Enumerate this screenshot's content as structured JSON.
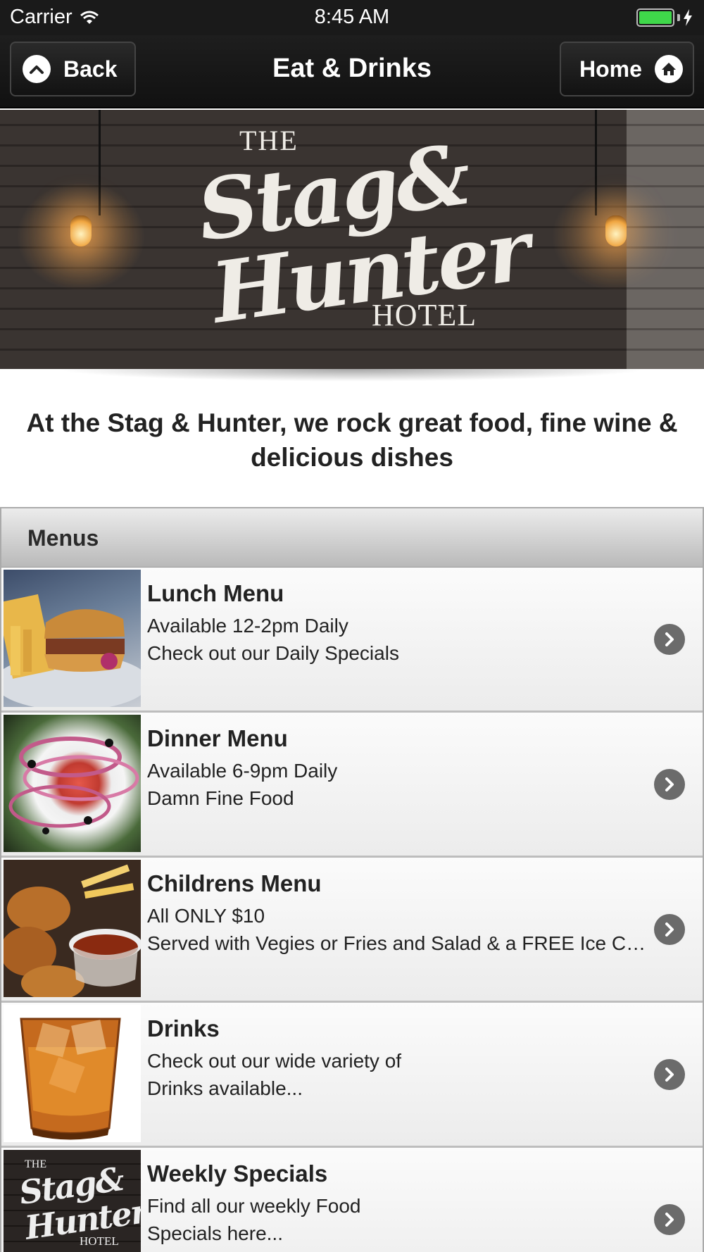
{
  "status_bar": {
    "carrier": "Carrier",
    "time": "8:45 AM"
  },
  "nav": {
    "back_label": "Back",
    "title": "Eat & Drinks",
    "home_label": "Home"
  },
  "banner": {
    "logo_the": "THE",
    "logo_stag": "Stag&",
    "logo_hunter": "Hunter",
    "logo_hotel": "HOTEL"
  },
  "intro_text": "At the Stag & Hunter, we rock great food, fine wine & delicious dishes",
  "menus": {
    "header": "Menus",
    "items": [
      {
        "title": "Lunch Menu",
        "line1": "Available 12-2pm Daily",
        "line2": "Check out our Daily Specials",
        "thumb_icon": "burger-photo"
      },
      {
        "title": "Dinner Menu",
        "line1": "Available 6-9pm Daily",
        "line2": "Damn Fine Food",
        "thumb_icon": "salad-photo"
      },
      {
        "title": "Childrens Menu",
        "line1": "All ONLY $10",
        "line2": "Served with Vegies or Fries and Salad & a FREE Ice Cream",
        "thumb_icon": "nuggets-photo"
      },
      {
        "title": "Drinks",
        "line1": "Check out our wide variety of",
        "line2": "Drinks available...",
        "thumb_icon": "whiskey-glass-photo"
      },
      {
        "title": "Weekly Specials",
        "line1": "Find all our weekly Food",
        "line2": "Specials here...",
        "thumb_icon": "logo-thumb"
      }
    ]
  },
  "thumb_logo": {
    "the": "THE",
    "stag": "Stag&",
    "hunter": "Hunter",
    "hotel": "HOTEL"
  },
  "colors": {
    "battery": "#3fd84a",
    "navbar": "#111111",
    "chevron": "#6b6b6b"
  }
}
